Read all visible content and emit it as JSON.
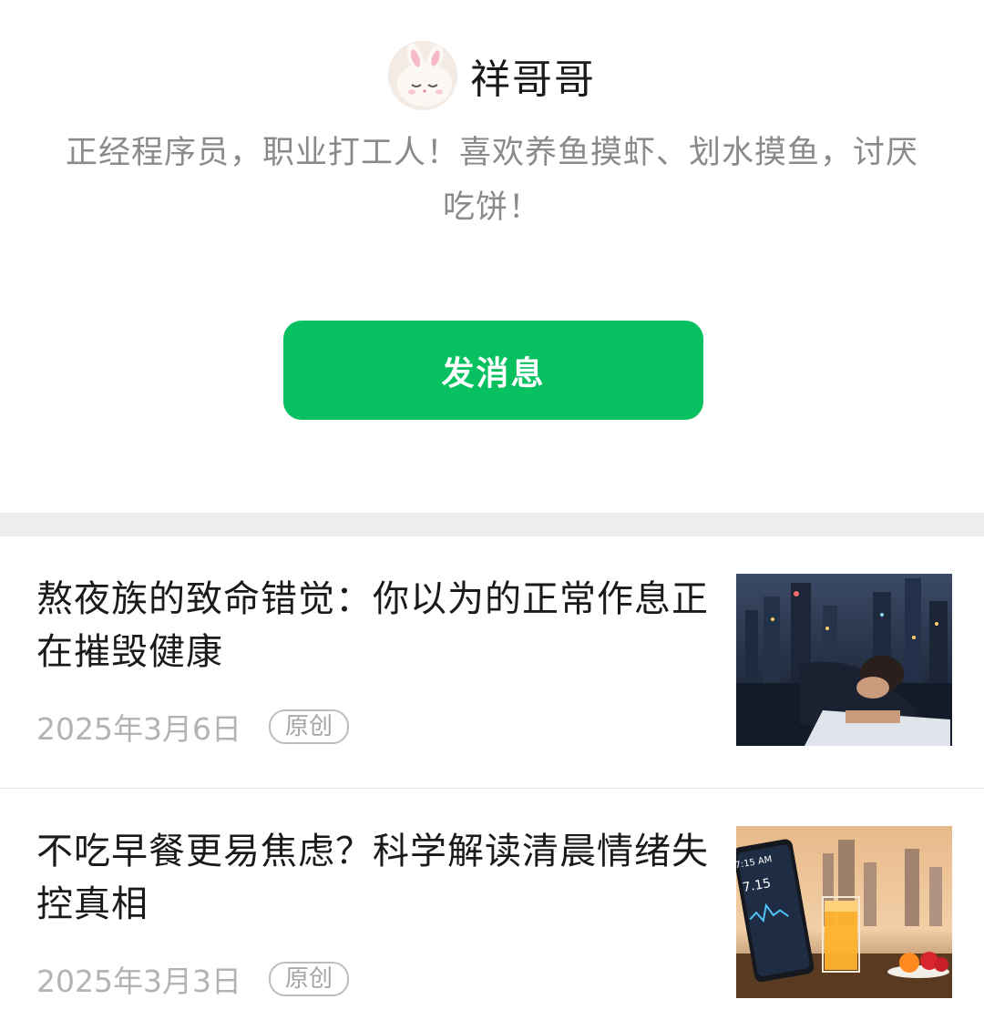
{
  "profile": {
    "name": "祥哥哥",
    "bio": "正经程序员，职业打工人！喜欢养鱼摸虾、划水摸鱼，讨厌吃饼！",
    "message_button": "发消息",
    "avatar_icon": "bunny-avatar-icon"
  },
  "colors": {
    "accent": "#07c160",
    "divider": "#ededed",
    "meta_text": "#b3b3b3"
  },
  "articles": [
    {
      "title": "熬夜族的致命错觉：你以为的正常作息正在摧毁健康",
      "date": "2025年3月6日",
      "badge": "原创",
      "thumbnail_icon": "man-sleeping-at-desk-icon"
    },
    {
      "title": "不吃早餐更易焦虑？科学解读清晨情绪失控真相",
      "date": "2025年3月3日",
      "badge": "原创",
      "thumbnail_icon": "phone-and-orange-juice-icon",
      "thumbnail_text": {
        "phone_time": "7:15 AM",
        "phone_big": "7.15"
      }
    }
  ]
}
